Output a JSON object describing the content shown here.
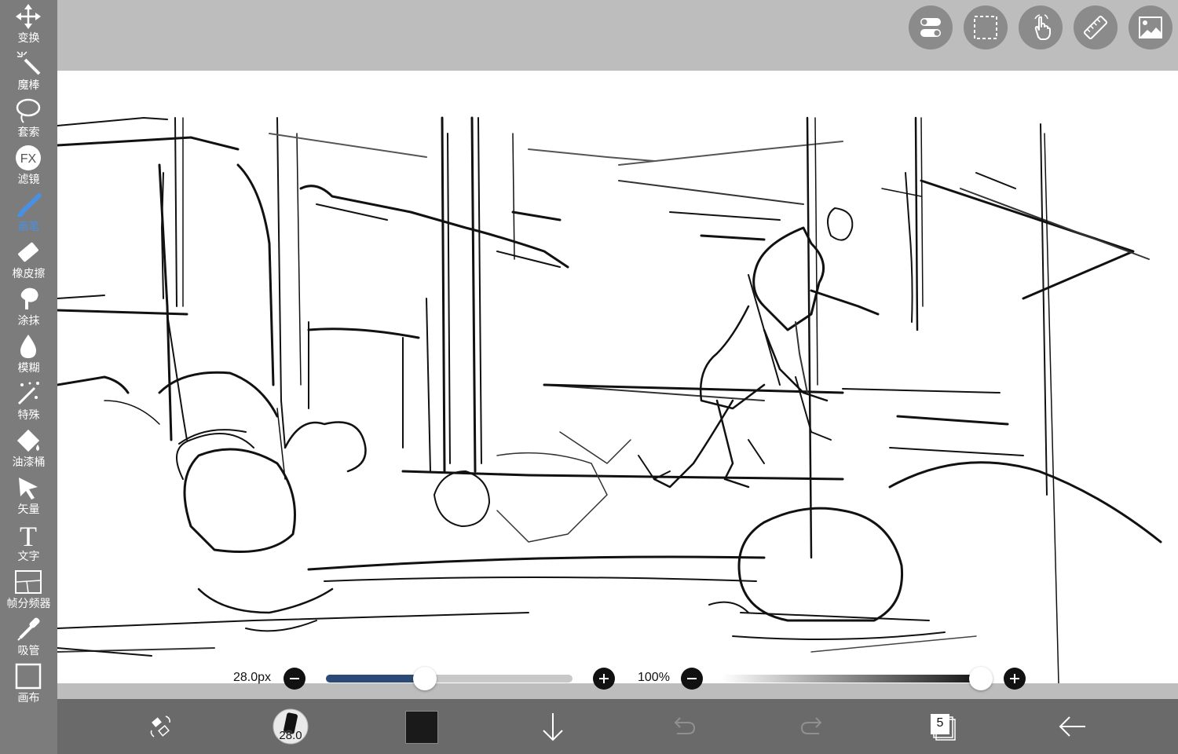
{
  "toolbar": {
    "items": [
      {
        "label": "变换",
        "icon": "move-arrows-icon"
      },
      {
        "label": "魔棒",
        "icon": "magic-wand-icon"
      },
      {
        "label": "套索",
        "icon": "lasso-icon"
      },
      {
        "label": "滤镜",
        "icon": "fx-filter-icon",
        "icon_text": "FX"
      },
      {
        "label": "画笔",
        "icon": "brush-icon",
        "active": true
      },
      {
        "label": "橡皮擦",
        "icon": "eraser-icon"
      },
      {
        "label": "涂抹",
        "icon": "smudge-icon"
      },
      {
        "label": "模糊",
        "icon": "blur-drop-icon"
      },
      {
        "label": "特殊",
        "icon": "special-sparkle-icon"
      },
      {
        "label": "油漆桶",
        "icon": "paint-bucket-icon"
      },
      {
        "label": "矢量",
        "icon": "vector-arrow-icon"
      },
      {
        "label": "文字",
        "icon": "text-icon",
        "icon_text": "T"
      },
      {
        "label": "帧分频器",
        "icon": "frame-divider-icon"
      },
      {
        "label": "吸管",
        "icon": "eyedropper-icon"
      },
      {
        "label": "画布",
        "icon": "canvas-icon"
      }
    ]
  },
  "topbar": {
    "buttons": [
      "toggle-switch-icon",
      "selection-icon",
      "gesture-hand-icon",
      "ruler-icon",
      "image-icon"
    ]
  },
  "brush": {
    "size_label": "28.0px",
    "size_fraction": 0.4,
    "opacity_label": "100%",
    "opacity_fraction": 1.0
  },
  "bottombar": {
    "brush_size_badge": "28.0",
    "current_color": "#1a1a1a",
    "layer_count": "5"
  },
  "colors": {
    "toolbar_bg": "#696969",
    "active_tool": "#4a90e2",
    "top_bar": "#bdbdbd",
    "bottom_bar": "#6a6a6a",
    "size_track": "#2c4a78"
  }
}
